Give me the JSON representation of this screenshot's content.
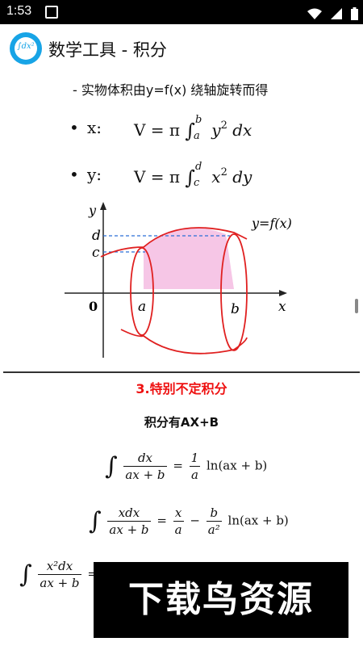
{
  "status": {
    "time": "1:53"
  },
  "app": {
    "title": "数学工具 - 积分",
    "logo_text": "∫dx²"
  },
  "content": {
    "subtitle": "- 实物体积由y=f(x) 绕轴旋转而得",
    "formula_x": {
      "bullet": "•",
      "var": "x:",
      "lhs": "V = π",
      "upper": "b",
      "lower": "a",
      "body_var": "y",
      "sup": "2",
      "diff": "dx"
    },
    "formula_y": {
      "bullet": "•",
      "var": "y:",
      "lhs": "V = π",
      "upper": "d",
      "lower": "c",
      "body_var": "x",
      "sup": "2",
      "diff": "dy"
    },
    "diagram_labels": {
      "y": "y",
      "x": "x",
      "d": "d",
      "c": "c",
      "zero": "0",
      "a": "a",
      "b": "b",
      "fx": "y=f(x)"
    },
    "section_heading": "3.特别不定积分",
    "section_sub": "积分有AX+B",
    "f1": {
      "num": "dx",
      "den": "ax + b",
      "eq": "=",
      "num2": "1",
      "den2": "a",
      "tail": "ln(ax + b)"
    },
    "f2": {
      "num": "xdx",
      "den": "ax + b",
      "eq": "=",
      "n1": "x",
      "d1": "a",
      "minus": "−",
      "n2": "b",
      "d2": "a²",
      "tail": "ln(ax + b)"
    },
    "f3": {
      "num": "x²dx",
      "den": "ax + b",
      "eq": "="
    },
    "watermark": "下载鸟资源"
  }
}
